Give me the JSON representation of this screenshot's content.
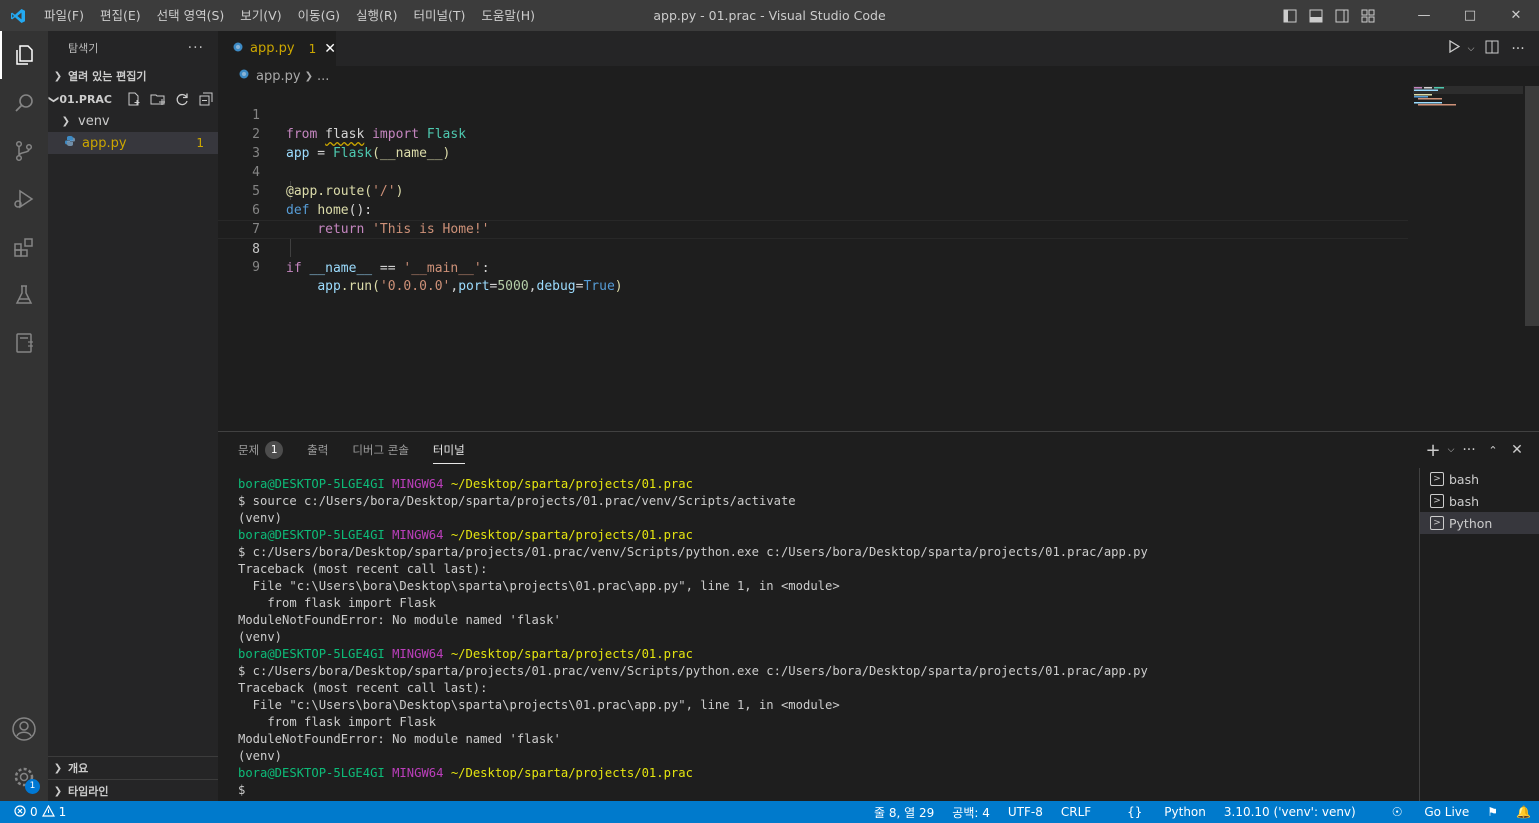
{
  "titlebar": {
    "menu": [
      "파일(F)",
      "편집(E)",
      "선택 영역(S)",
      "보기(V)",
      "이동(G)",
      "실행(R)",
      "터미널(T)",
      "도움말(H)"
    ],
    "title": "app.py - 01.prac - Visual Studio Code"
  },
  "sidebar": {
    "title": "탐색기",
    "open_editors": "열려 있는 편집기",
    "folder": "01.PRAC",
    "items": [
      {
        "label": "venv"
      },
      {
        "label": "app.py",
        "badge": "1"
      }
    ],
    "outline": "개요",
    "timeline": "타임라인"
  },
  "activity_badge": "1",
  "editor": {
    "tab_label": "app.py",
    "tab_problems": "1",
    "breadcrumb_file": "app.py",
    "breadcrumb_rest": "...",
    "lines": [
      {
        "n": "1"
      },
      {
        "n": "2"
      },
      {
        "n": "3"
      },
      {
        "n": "4"
      },
      {
        "n": "5"
      },
      {
        "n": "6"
      },
      {
        "n": "7"
      },
      {
        "n": "8"
      },
      {
        "n": "9"
      }
    ],
    "code": {
      "l1_from": "from",
      "l1_mod": "flask",
      "l1_import": "import",
      "l1_cls": "Flask",
      "l2_var": "app",
      "l2_eq": " = ",
      "l2_cls": "Flask",
      "l2_rest": "(__name__)",
      "l4_dec": "@app.route",
      "l4_p1": "(",
      "l4_str": "'/'",
      "l4_p2": ")",
      "l5_def": "def",
      "l5_fn": "home",
      "l5_rest": "():",
      "l6_ret": "return",
      "l6_str": "'This is Home!'",
      "l8_if": "if",
      "l8_var": "__name__",
      "l8_eq": " == ",
      "l8_str": "'__main__'",
      "l8_col": ":",
      "l9_obj": "app",
      "l9_fn": ".run",
      "l9_p1": "(",
      "l9_str": "'0.0.0.0'",
      "l9_c1": ",",
      "l9_port": "port",
      "l9_eq1": "=",
      "l9_num": "5000",
      "l9_c2": ",",
      "l9_debug": "debug",
      "l9_eq2": "=",
      "l9_true": "True",
      "l9_p2": ")"
    }
  },
  "panel": {
    "tabs": [
      "문제",
      "출력",
      "디버그 콘솔",
      "터미널"
    ],
    "problems_count": "1",
    "terminal_list": [
      "bash",
      "bash",
      "Python"
    ],
    "terminal": [
      {
        "type": "prompt",
        "user": "bora@DESKTOP-5LGE4GI",
        "env": "MINGW64",
        "path": "~/Desktop/sparta/projects/01.prac"
      },
      {
        "type": "text",
        "text": "$ source c:/Users/bora/Desktop/sparta/projects/01.prac/venv/Scripts/activate"
      },
      {
        "type": "text",
        "text": "(venv)"
      },
      {
        "type": "prompt",
        "user": "bora@DESKTOP-5LGE4GI",
        "env": "MINGW64",
        "path": "~/Desktop/sparta/projects/01.prac"
      },
      {
        "type": "text",
        "text": "$ c:/Users/bora/Desktop/sparta/projects/01.prac/venv/Scripts/python.exe c:/Users/bora/Desktop/sparta/projects/01.prac/app.py"
      },
      {
        "type": "text",
        "text": "Traceback (most recent call last):"
      },
      {
        "type": "text",
        "text": "  File \"c:\\Users\\bora\\Desktop\\sparta\\projects\\01.prac\\app.py\", line 1, in <module>"
      },
      {
        "type": "text",
        "text": "    from flask import Flask"
      },
      {
        "type": "text",
        "text": "ModuleNotFoundError: No module named 'flask'"
      },
      {
        "type": "text",
        "text": "(venv)"
      },
      {
        "type": "prompt",
        "user": "bora@DESKTOP-5LGE4GI",
        "env": "MINGW64",
        "path": "~/Desktop/sparta/projects/01.prac"
      },
      {
        "type": "text",
        "text": "$ c:/Users/bora/Desktop/sparta/projects/01.prac/venv/Scripts/python.exe c:/Users/bora/Desktop/sparta/projects/01.prac/app.py"
      },
      {
        "type": "text",
        "text": "Traceback (most recent call last):"
      },
      {
        "type": "text",
        "text": "  File \"c:\\Users\\bora\\Desktop\\sparta\\projects\\01.prac\\app.py\", line 1, in <module>"
      },
      {
        "type": "text",
        "text": "    from flask import Flask"
      },
      {
        "type": "text",
        "text": "ModuleNotFoundError: No module named 'flask'"
      },
      {
        "type": "text",
        "text": "(venv)"
      },
      {
        "type": "prompt",
        "user": "bora@DESKTOP-5LGE4GI",
        "env": "MINGW64",
        "path": "~/Desktop/sparta/projects/01.prac"
      },
      {
        "type": "text",
        "text": "$"
      }
    ]
  },
  "statusbar": {
    "errors": "0",
    "warnings": "1",
    "position": "줄 8, 열 29",
    "spaces": "공백: 4",
    "encoding": "UTF-8",
    "eol": "CRLF",
    "language": "Python",
    "interpreter": "3.10.10 ('venv': venv)",
    "golive": "Go Live"
  },
  "colors": {
    "accent": "#007acc",
    "warning": "#cca700",
    "terminal_green": "#0dbc79",
    "terminal_magenta": "#bc3fbc",
    "terminal_yellow": "#e5e510"
  }
}
